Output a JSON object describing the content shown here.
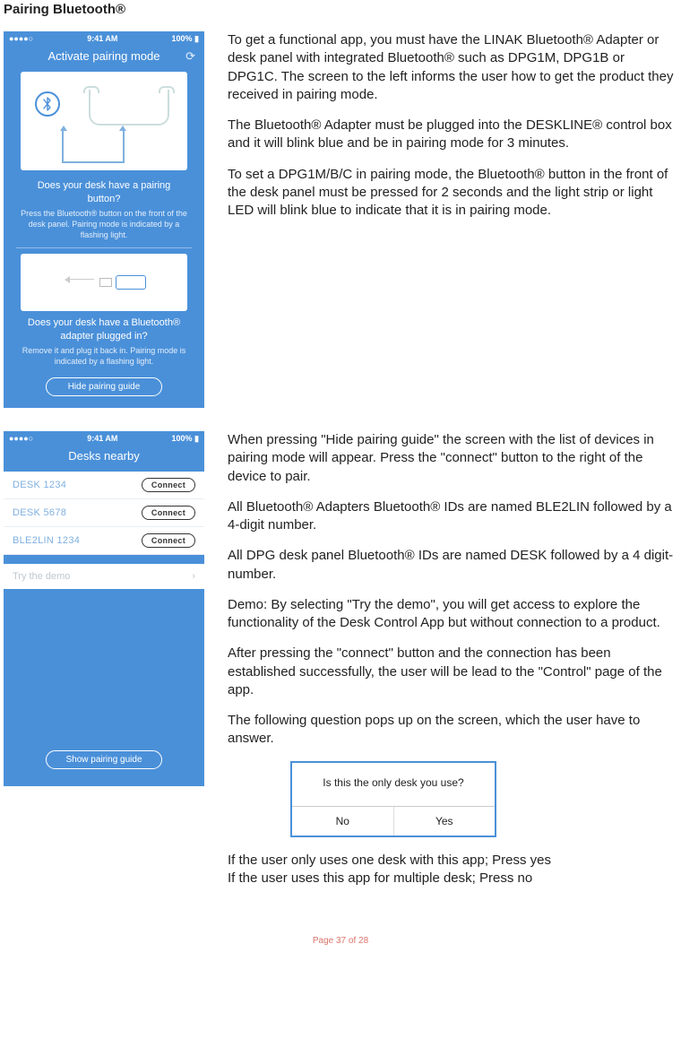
{
  "title": "Pairing Bluetooth®",
  "phone1": {
    "status_left": "●●●●○",
    "status_time": "9:41 AM",
    "status_right": "100% ▮",
    "nav_title": "Activate pairing mode",
    "refresh_icon": "⟳",
    "bt_glyph": "⎇",
    "q1_main": "Does your desk have a pairing button?",
    "q1_sub": "Press the Bluetooth® button on the front of the desk panel. Pairing mode is indicated by a flashing light.",
    "q2_main": "Does your desk have a Bluetooth® adapter plugged in?",
    "q2_sub": "Remove it and plug it back in. Pairing mode is indicated by a flashing light.",
    "hide_btn": "Hide pairing guide"
  },
  "text1": {
    "p1": "To get a functional app, you must have the LINAK Bluetooth® Adapter or desk panel with integrated Bluetooth® such as DPG1M, DPG1B or DPG1C. The screen to the left informs the user how to get the product they received in pairing mode.",
    "p2": "The Bluetooth® Adapter must be plugged into the DESKLINE® control box and it will blink blue and be in pairing mode for 3 minutes.",
    "p3": "To set a DPG1M/B/C in pairing mode, the Bluetooth® button in the front of the desk panel must be pressed for 2 seconds and the light strip or light LED will blink blue to indicate that it is in pairing mode."
  },
  "phone2": {
    "status_left": "●●●●○",
    "status_time": "9:41 AM",
    "status_right": "100% ▮",
    "nav_title": "Desks nearby",
    "rows": [
      {
        "label": "DESK 1234",
        "btn": "Connect"
      },
      {
        "label": "DESK 5678",
        "btn": "Connect"
      },
      {
        "label": "BLE2LIN 1234",
        "btn": "Connect"
      }
    ],
    "demo_label": "Try the demo",
    "demo_chev": "›",
    "show_btn": "Show pairing guide"
  },
  "text2": {
    "p1": "When pressing \"Hide pairing guide\" the screen with the list of devices in pairing mode will appear. Press the \"connect\" button to the right of the device to pair.",
    "p2": "All Bluetooth® Adapters Bluetooth® IDs are named BLE2LIN followed by a 4-digit number.",
    "p3": "All DPG desk panel Bluetooth® IDs are named DESK followed by a 4 digit-number.",
    "p4": "Demo: By selecting \"Try the demo\", you will get access to explore the functionality of the Desk Control App but without connection to a product.",
    "p5": "After pressing the \"connect\" button and the connection has been established successfully, the user will be lead to the \"Control\" page of the app.",
    "p6": "The following question pops up on the screen, which the user have to answer.",
    "p7": "If the user only uses one desk with this app; Press yes",
    "p8": "If the user uses this app for multiple desk; Press no"
  },
  "dialog": {
    "question": "Is this the only desk you use?",
    "no": "No",
    "yes": "Yes"
  },
  "footer": "Page 37 of 28"
}
